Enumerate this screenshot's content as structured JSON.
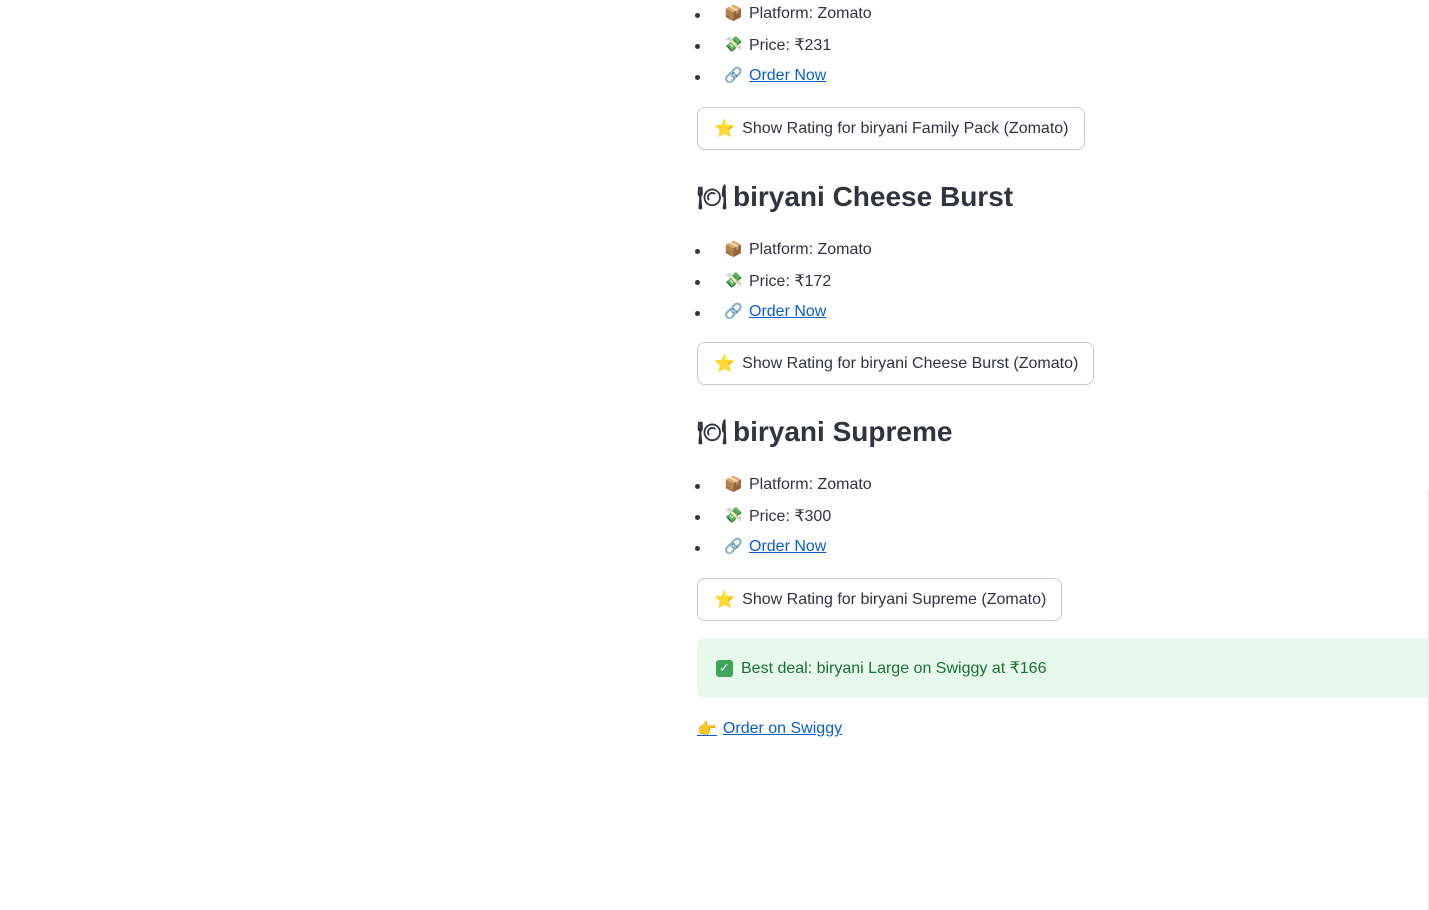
{
  "items": [
    {
      "title": null,
      "platform_label": "Platform: Zomato",
      "price_label": "Price: ₹231",
      "order_label": "Order Now",
      "rating_button": "Show Rating for biryani Family Pack (Zomato)"
    },
    {
      "title": "biryani Cheese Burst",
      "platform_label": "Platform: Zomato",
      "price_label": "Price: ₹172",
      "order_label": "Order Now",
      "rating_button": "Show Rating for biryani Cheese Burst (Zomato)"
    },
    {
      "title": "biryani Supreme",
      "platform_label": "Platform: Zomato",
      "price_label": "Price: ₹300",
      "order_label": "Order Now",
      "rating_button": "Show Rating for biryani Supreme (Zomato)"
    }
  ],
  "best_deal": {
    "text": "Best deal: biryani Large on Swiggy at ₹166",
    "color": "#177233",
    "background": "#e7f9ec"
  },
  "order_swiggy_label": "Order on Swiggy",
  "icons": {
    "platform": "package-icon",
    "price": "money-icon",
    "link": "link-icon",
    "rating": "star-icon",
    "title": "plate-cutlery-icon",
    "success": "check-icon",
    "order": "pointing-hand-icon"
  },
  "accent_link_color": "#0b5ec9"
}
